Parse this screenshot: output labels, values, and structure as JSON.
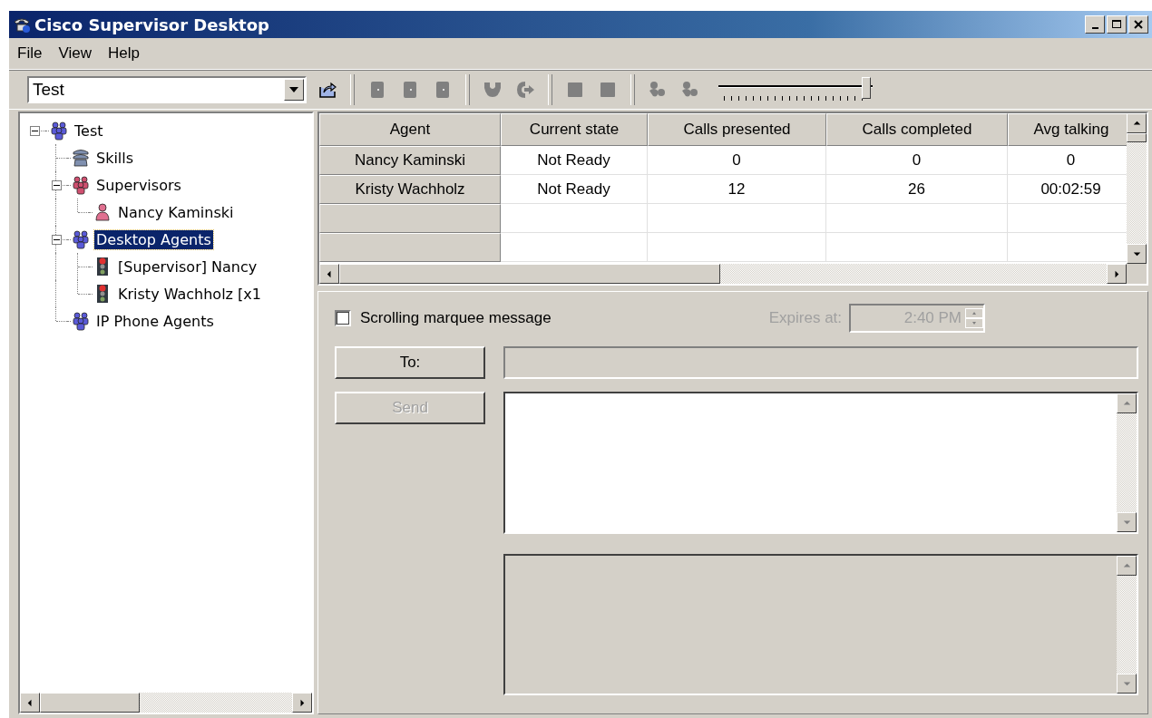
{
  "window": {
    "title": "Cisco Supervisor Desktop"
  },
  "menu": [
    {
      "label": "File"
    },
    {
      "label": "View"
    },
    {
      "label": "Help"
    }
  ],
  "team_selector": {
    "value": "Test"
  },
  "toolbar": {
    "buttons": [
      {
        "kind": "export",
        "disabled": false
      },
      {
        "kind": "agent",
        "disabled": true
      },
      {
        "kind": "agent",
        "disabled": true
      },
      {
        "kind": "agent",
        "disabled": true
      },
      {
        "kind": "phone",
        "disabled": true
      },
      {
        "kind": "forward",
        "disabled": true
      },
      {
        "kind": "square",
        "disabled": true
      },
      {
        "kind": "square",
        "disabled": true
      },
      {
        "kind": "chat",
        "disabled": true
      },
      {
        "kind": "chat",
        "disabled": true
      }
    ],
    "slider": {
      "level": 1
    }
  },
  "tree": [
    {
      "label": "Test",
      "kind": "team",
      "expanded": true,
      "selected": false,
      "children": [
        {
          "label": "Skills",
          "kind": "skills",
          "selected": false
        },
        {
          "label": "Supervisors",
          "kind": "supervisors",
          "expanded": true,
          "selected": false,
          "children": [
            {
              "label": "Nancy Kaminski",
              "kind": "person",
              "selected": false
            }
          ]
        },
        {
          "label": "Desktop Agents",
          "kind": "team",
          "expanded": true,
          "selected": true,
          "children": [
            {
              "label": "[Supervisor] Nancy",
              "kind": "agent",
              "selected": false
            },
            {
              "label": "Kristy Wachholz [x1",
              "kind": "agent",
              "selected": false
            }
          ]
        },
        {
          "label": "IP Phone Agents",
          "kind": "team",
          "selected": false
        }
      ]
    }
  ],
  "table": {
    "columns": [
      "Agent",
      "Current state",
      "Calls presented",
      "Calls completed",
      "Avg talking"
    ],
    "rows": [
      [
        "Nancy Kaminski",
        "Not Ready",
        "0",
        "0",
        "0"
      ],
      [
        "Kristy Wachholz",
        "Not Ready",
        "12",
        "26",
        "00:02:59"
      ]
    ]
  },
  "marquee": {
    "checkbox": {
      "label": "Scrolling marquee message",
      "checked": false
    },
    "expires": {
      "label": "Expires at:",
      "value": "2:40 PM",
      "disabled": true
    }
  },
  "to_button": {
    "label": "To:",
    "disabled": false
  },
  "send_button": {
    "label": "Send",
    "disabled": true
  }
}
